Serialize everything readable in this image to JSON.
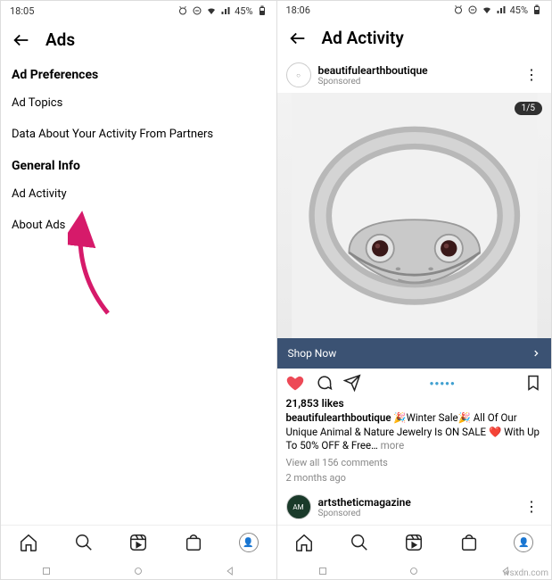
{
  "left": {
    "status": {
      "time": "18:05",
      "battery": "45%"
    },
    "header": {
      "title": "Ads"
    },
    "section1": {
      "title": "Ad Preferences"
    },
    "row_topics": "Ad Topics",
    "row_data": "Data About Your Activity From Partners",
    "section2": {
      "title": "General Info"
    },
    "row_activity": "Ad Activity",
    "row_about": "About Ads"
  },
  "right": {
    "status": {
      "time": "18:06",
      "battery": "45%"
    },
    "header": {
      "title": "Ad Activity"
    },
    "post1": {
      "user": "beautifulearthboutique",
      "sub": "Sponsored",
      "badge": "1/5",
      "cta": "Shop Now",
      "likes": "21,853 likes",
      "caption_user": "beautifulearthboutique",
      "caption_text": " 🎉Winter Sale🎉 All Of Our Unique Animal & Nature Jewelry Is ON SALE ❤️ With Up To 50% OFF & Free…",
      "more": " more",
      "comments": "View all 156 comments",
      "age": "2 months ago"
    },
    "post2": {
      "user": "artstheticmagazine",
      "sub": "Sponsored"
    }
  },
  "watermark": "wsxdn.com"
}
